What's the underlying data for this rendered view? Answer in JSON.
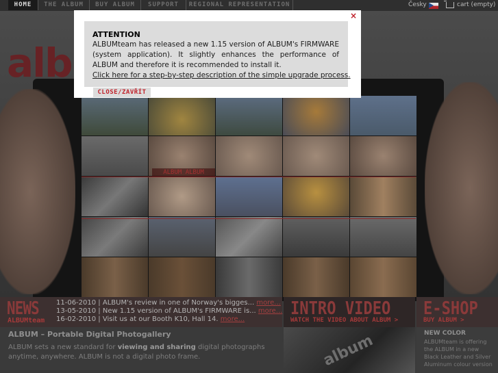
{
  "nav": {
    "items": [
      "HOME",
      "THE ALBUM",
      "BUY ALBUM",
      "SUPPORT",
      "REGIONAL REPRESENTATION"
    ],
    "active": "HOME",
    "language": "Česky",
    "cart": "cart (empty)",
    "icons": {
      "flag": "czech-flag-icon",
      "cart": "cart-icon"
    }
  },
  "logo": {
    "text": "album"
  },
  "hero": {
    "grid_label": "ALBUM ALBUM"
  },
  "news": {
    "title": "NEWS",
    "subtitle": "ALBUMteam",
    "items": [
      {
        "date": "11-06-2010",
        "text": "ALBUM's review in one of Norway's bigges...",
        "more": "more..."
      },
      {
        "date": "13-05-2010",
        "text": "New 1.15 version of ALBUM's FIRMWARE is...",
        "more": "more..."
      },
      {
        "date": "16-02-2010",
        "text": "Visit us at our Booth K10, Hall 14.",
        "more": "more..."
      }
    ]
  },
  "intro_video": {
    "title": "INTRO VIDEO",
    "subtitle": "WATCH THE VIDEO ABOUT ALBUM >",
    "thumb_logo": "album"
  },
  "eshop": {
    "title": "E-SHOP",
    "subtitle": "BUY ALBUM >",
    "new_color_title": "NEW COLOR",
    "new_color_text": "ALBUMteam is offering the ALBUM in a new Black Leather and Silver Aluminum colour version"
  },
  "about": {
    "title": "ALBUM – Portable Digital Photogallery",
    "text_prefix": "ALBUM sets a new standard for ",
    "text_bold": "viewing and sharing",
    "text_suffix": " digital photographs anytime, anywhere. ALBUM is not a digital photo frame."
  },
  "modal": {
    "title": "ATTENTION",
    "body": "ALBUMteam has released a new 1.15 version of ALBUM's FIRMWARE (system application). It slightly enhances the performance of ALBUM and therefore it is recommended to install it.",
    "link": "Click here for a step-by-step description of the simple upgrade process.",
    "close_label": "CLOSE/ZAVŘÍT",
    "close_x": "×"
  },
  "colors": {
    "accent": "#c0222b",
    "overlay": "#3a3a3a"
  }
}
